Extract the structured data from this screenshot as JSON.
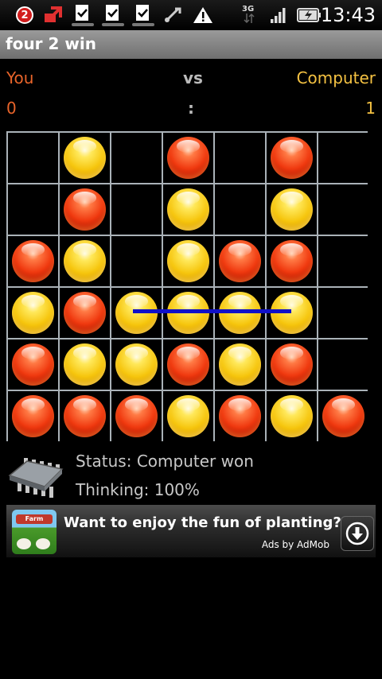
{
  "status_bar": {
    "notification_count": "2",
    "network_type": "3G",
    "time": "13:43",
    "icons": [
      "notification-badge-icon",
      "upload-icon",
      "download-done-icon",
      "download-done-icon",
      "download-done-icon",
      "usb-debug-icon",
      "warning-icon",
      "3g-data-icon",
      "signal-icon",
      "battery-charging-icon"
    ]
  },
  "app": {
    "title": "four 2 win"
  },
  "scoreboard": {
    "player_label": "You",
    "vs_label": "vs",
    "opponent_label": "Computer",
    "player_score": "0",
    "separator": ":",
    "opponent_score": "1",
    "colors": {
      "player": "#e8642a",
      "opponent": "#f5c242"
    }
  },
  "board": {
    "columns": 7,
    "rows": 6,
    "grid": [
      [
        "",
        "Y",
        "",
        "R",
        "",
        "R",
        ""
      ],
      [
        "",
        "R",
        "",
        "Y",
        "",
        "Y",
        ""
      ],
      [
        "R",
        "Y",
        "",
        "Y",
        "R",
        "R",
        ""
      ],
      [
        "Y",
        "R",
        "Y",
        "Y",
        "Y",
        "Y",
        ""
      ],
      [
        "R",
        "Y",
        "Y",
        "R",
        "Y",
        "R",
        ""
      ],
      [
        "R",
        "R",
        "R",
        "Y",
        "R",
        "Y",
        "R"
      ]
    ],
    "winning_line": {
      "row": 4,
      "from_column": 3,
      "to_column": 6
    },
    "colors": {
      "red": "#f03a10",
      "yellow": "#f6c60e",
      "grid": "#aab2b8",
      "win_line": "#1010c8"
    }
  },
  "status": {
    "status_text": "Status: Computer won",
    "thinking_text": "Thinking: 100%",
    "icon": "cpu-chip-icon"
  },
  "ad": {
    "thumb_text": "Farm",
    "headline": "Want to enjoy the fun of planting?",
    "attribution": "Ads by AdMob",
    "icon": "download-icon"
  }
}
